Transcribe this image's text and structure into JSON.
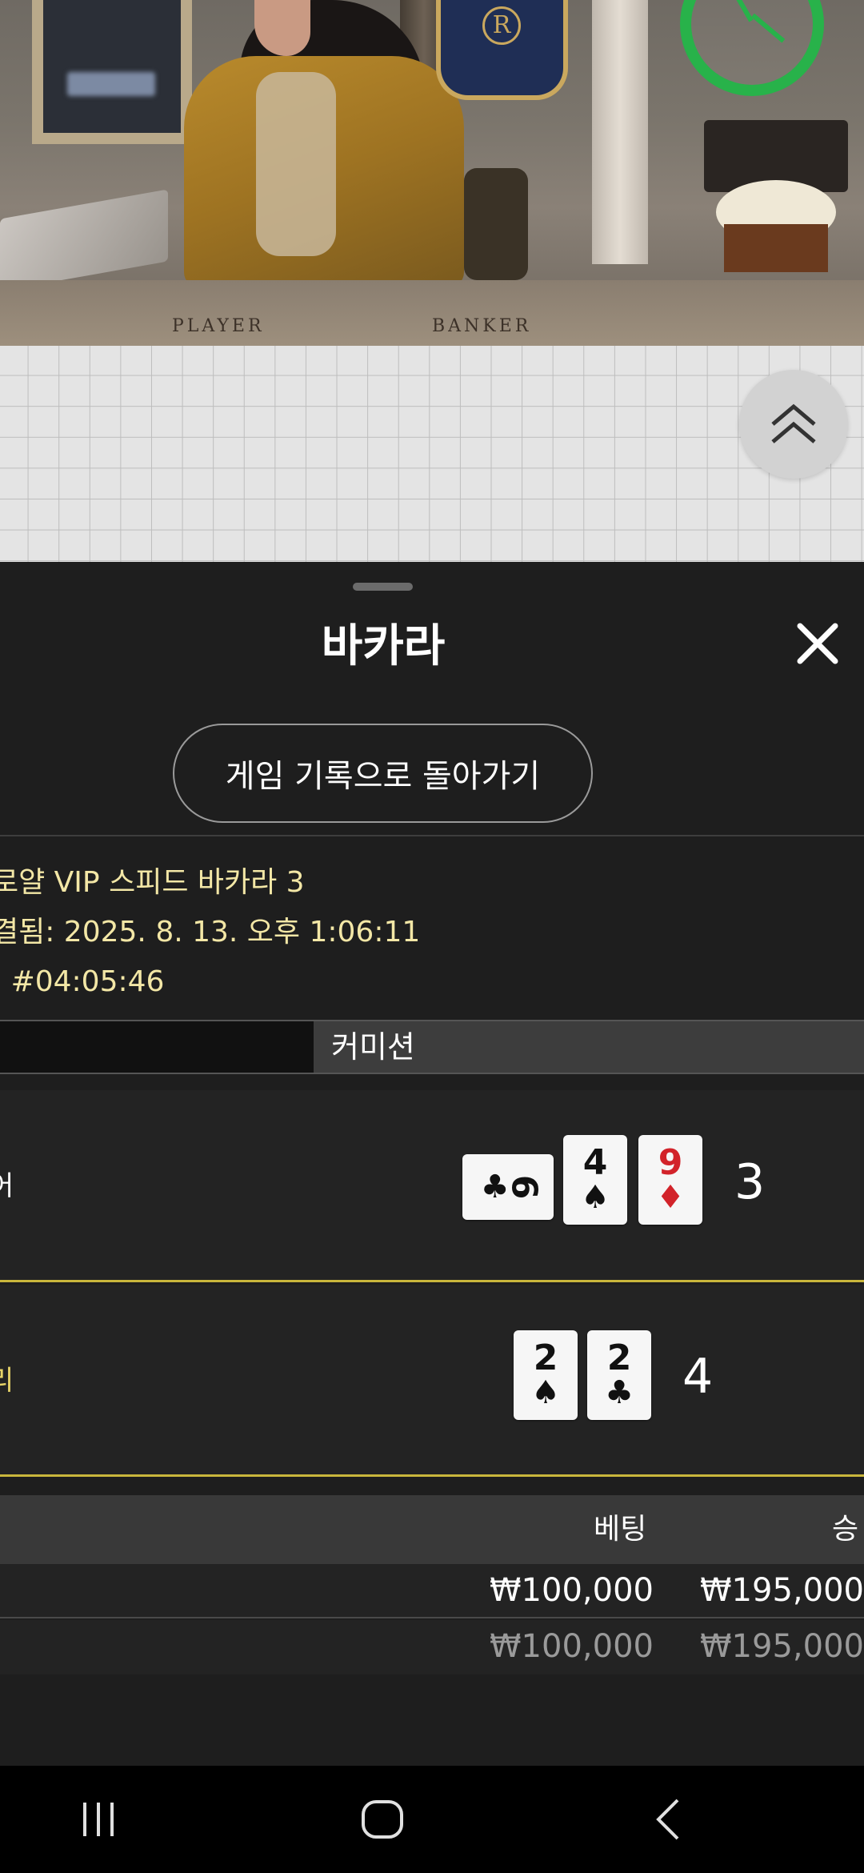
{
  "video": {
    "table_labels": {
      "player": "PLAYER",
      "banker": "BANKER"
    },
    "logo_letter": "R",
    "timer_color": "#28b24a"
  },
  "roadmap": {
    "expand_icon": "double-chevron-up-icon"
  },
  "sheet": {
    "title": "바카라",
    "close_icon": "close-icon",
    "back_button_label": "게임 기록으로 돌아가기",
    "info": {
      "table_name": "로얄 VIP 스피드 바카라 3",
      "settled_at": "결됨: 2025. 8. 13. 오후 1:06:11",
      "round_id": ": #04:05:46"
    },
    "tab_right_label": "커미션",
    "player": {
      "label": "어",
      "score": "3",
      "cards": [
        {
          "rank": "6",
          "suit": "♣",
          "color": "black",
          "orientation": "sideways"
        },
        {
          "rank": "4",
          "suit": "♠",
          "color": "black",
          "orientation": "upright"
        },
        {
          "rank": "9",
          "suit": "♦",
          "color": "red",
          "orientation": "upright"
        }
      ]
    },
    "banker": {
      "label": "리",
      "score": "4",
      "cards": [
        {
          "rank": "2",
          "suit": "♠",
          "color": "black"
        },
        {
          "rank": "2",
          "suit": "♣",
          "color": "black"
        }
      ]
    },
    "bets": {
      "header": {
        "bet": "베팅",
        "win": "승"
      },
      "rows": [
        {
          "bet": "₩100,000",
          "win": "₩195,000"
        },
        {
          "bet": "₩100,000",
          "win": "₩195,000"
        }
      ]
    },
    "accent_color": "#c9b63c"
  },
  "navbar": {
    "recent_icon": "recent-apps-icon",
    "home_icon": "home-icon",
    "back_icon": "back-icon"
  }
}
